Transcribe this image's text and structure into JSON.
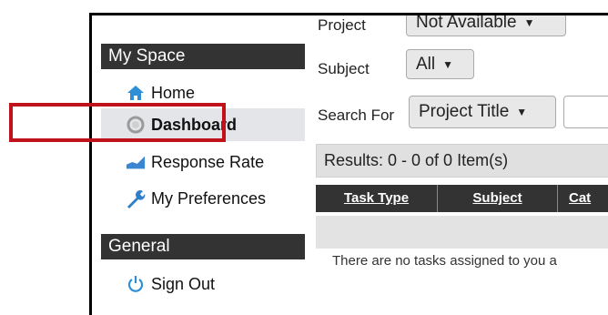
{
  "sidebar": {
    "sections": [
      {
        "title": "My Space"
      },
      {
        "title": "General"
      }
    ],
    "items": [
      {
        "label": "Home",
        "icon": "home-icon"
      },
      {
        "label": "Dashboard",
        "icon": "dashboard-icon",
        "selected": true
      },
      {
        "label": "Response Rate",
        "icon": "chart-icon"
      },
      {
        "label": "My Preferences",
        "icon": "wrench-icon"
      },
      {
        "label": "Sign Out",
        "icon": "power-icon"
      }
    ]
  },
  "filters": {
    "project_label": "Project",
    "project_value": "Not Available",
    "subject_label": "Subject",
    "subject_value": "All",
    "search_label": "Search For",
    "search_field_value": "Project Title",
    "search_input_value": ""
  },
  "results": {
    "summary": "Results: 0 - 0 of 0 Item(s)",
    "columns": [
      "Task Type",
      "Subject",
      "Cat"
    ],
    "empty_message": "There are no tasks assigned to you a"
  },
  "colors": {
    "header_bg": "#333333",
    "selected_bg": "#e3e5e8",
    "highlight": "#c0121a",
    "home_icon": "#2e8fd6",
    "power_icon": "#2e8fd6"
  }
}
